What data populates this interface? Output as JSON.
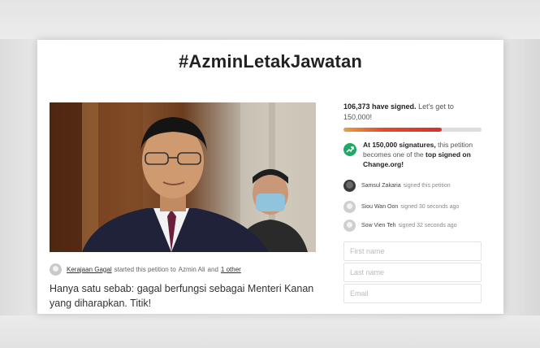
{
  "petition": {
    "title": "#AzminLetakJawatan",
    "starter": {
      "name": "Kerajaan Gagal",
      "started_text": "started this petition to",
      "target": "Azmin Ali",
      "and_text": "and",
      "other": "1 other"
    },
    "description": "Hanya satu sebab: gagal berfungsi sebagai Menteri Kanan yang diharapkan. Titik!"
  },
  "sidebar": {
    "signed_count": "106,373 have signed.",
    "goal_prompt": "Let's get to 150,000!",
    "progress_fraction": 0.709,
    "goal": {
      "part1": "At 150,000 signatures,",
      "part2": "this petition becomes one of the",
      "part3": "top signed on Change.org!"
    },
    "signers": [
      {
        "name": "Samsul Zakaria",
        "text": "signed this petition",
        "avatar": "dark"
      },
      {
        "name": "Siou Wan Oon",
        "text": "signed 30 seconds ago",
        "avatar": "light"
      },
      {
        "name": "Sow Vien Teh",
        "text": "signed 32 seconds ago",
        "avatar": "light"
      }
    ],
    "form": {
      "first_name_placeholder": "First name",
      "last_name_placeholder": "Last name",
      "email_placeholder": "Email"
    }
  },
  "colors": {
    "progress": "#d5312e",
    "trend_icon": "#1fa866"
  }
}
